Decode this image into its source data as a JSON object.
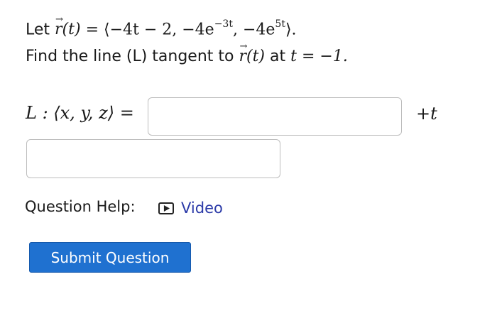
{
  "problem": {
    "let_word": "Let",
    "r_func": "r(t)",
    "eq_open": "= ⟨−4t − 2, −4e",
    "exp1": "−3t",
    "mid": ", −4e",
    "exp2": "5t",
    "close": "⟩.",
    "find_text": "Find the line (L) tangent to",
    "r_func2": "r(t)",
    "at_text": "at",
    "t_eq": "t = −1."
  },
  "answer": {
    "label": "L : ⟨x, y, z⟩ =",
    "point_value": "",
    "plus_t": "+t",
    "direction_value": ""
  },
  "help": {
    "label": "Question Help:",
    "video_label": "Video",
    "video_icon": "play-icon"
  },
  "submit": {
    "label": "Submit Question",
    "color": "#1f71d0"
  }
}
